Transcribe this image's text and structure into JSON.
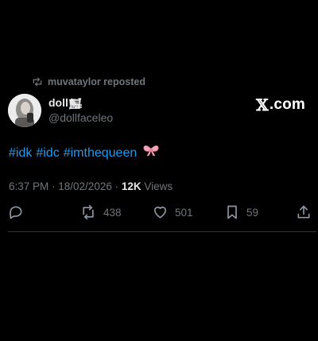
{
  "post": {
    "reposted_by": "muvataylor reposted",
    "author": {
      "display_name": "doll𒂐",
      "handle": "@dollfaceleo"
    },
    "brand": {
      "x": "𝕏",
      "suffix": ".com"
    },
    "text": {
      "hashtags": [
        "#idk",
        "#idc",
        "#imthequeen"
      ],
      "emoji": "🎀"
    },
    "meta": {
      "timestamp": "6:37 PM · 18/02/2026 ·",
      "views_count": "12K",
      "views_label": "Views"
    },
    "actions": {
      "reply_count": "",
      "repost_count": "438",
      "like_count": "501",
      "bookmark_count": "59"
    }
  },
  "colors": {
    "background": "#000000",
    "text_primary": "#e7e9ea",
    "text_secondary": "#71767b",
    "accent": "#1d9bf0",
    "divider": "#2f3336"
  },
  "icons": {
    "repost_header": "repost-icon",
    "reply": "reply-icon",
    "repost": "repost-icon",
    "like": "heart-icon",
    "bookmark": "bookmark-icon",
    "share": "share-icon"
  }
}
